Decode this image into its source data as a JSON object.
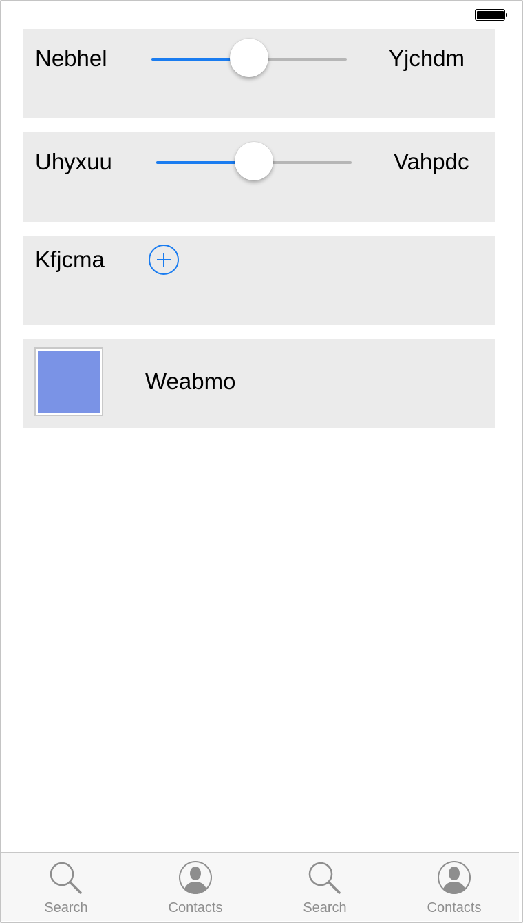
{
  "colors": {
    "accent": "#1a7cf0",
    "cell_background": "#ebebeb",
    "swatch": "#7a93e6",
    "tab_inactive": "#8e8e8e"
  },
  "status_bar": {
    "battery_icon": "battery-full-icon",
    "battery_level": 1.0
  },
  "rows": {
    "slider1": {
      "label": "Nebhel",
      "value_label": "Yjchdm",
      "value": 0.5
    },
    "slider2": {
      "label": "Uhyxuu",
      "value_label": "Vahpdc",
      "value": 0.5
    },
    "add": {
      "label": "Kfjcma",
      "icon": "plus-circle-icon"
    },
    "color": {
      "label": "Weabmo",
      "swatch_color": "#7a93e6"
    }
  },
  "tabbar": {
    "items": [
      {
        "label": "Search",
        "icon": "search-icon"
      },
      {
        "label": "Contacts",
        "icon": "contact-icon"
      },
      {
        "label": "Search",
        "icon": "search-icon"
      },
      {
        "label": "Contacts",
        "icon": "contact-icon"
      }
    ]
  }
}
